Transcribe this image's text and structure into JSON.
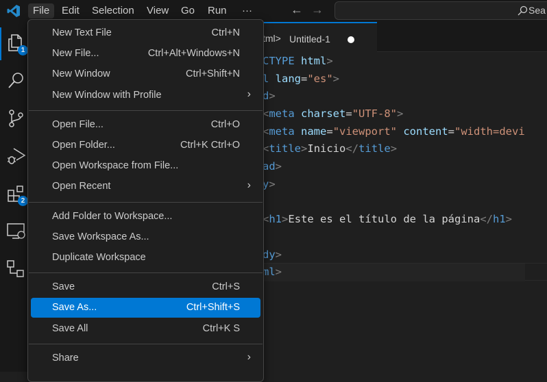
{
  "menubar": {
    "items": [
      "File",
      "Edit",
      "Selection",
      "View",
      "Go",
      "Run",
      "···"
    ],
    "active": "File"
  },
  "search": {
    "placeholder": "Sea"
  },
  "activity": [
    {
      "icon": "explorer-icon",
      "badge": "1"
    },
    {
      "icon": "search-icon"
    },
    {
      "icon": "source-control-icon"
    },
    {
      "icon": "run-debug-icon"
    },
    {
      "icon": "extensions-icon",
      "badge": "2"
    },
    {
      "icon": "remote-explorer-icon"
    },
    {
      "icon": "remote-tree-icon"
    }
  ],
  "tab": {
    "breadcrumb": "tml>",
    "title": "Untitled-1",
    "dirty": true
  },
  "file_menu": {
    "groups": [
      [
        {
          "label": "New Text File",
          "shortcut": "Ctrl+N"
        },
        {
          "label": "New File...",
          "shortcut": "Ctrl+Alt+Windows+N"
        },
        {
          "label": "New Window",
          "shortcut": "Ctrl+Shift+N"
        },
        {
          "label": "New Window with Profile",
          "submenu": true
        }
      ],
      [
        {
          "label": "Open File...",
          "shortcut": "Ctrl+O"
        },
        {
          "label": "Open Folder...",
          "shortcut": "Ctrl+K Ctrl+O"
        },
        {
          "label": "Open Workspace from File..."
        },
        {
          "label": "Open Recent",
          "submenu": true
        }
      ],
      [
        {
          "label": "Add Folder to Workspace..."
        },
        {
          "label": "Save Workspace As..."
        },
        {
          "label": "Duplicate Workspace"
        }
      ],
      [
        {
          "label": "Save",
          "shortcut": "Ctrl+S"
        },
        {
          "label": "Save As...",
          "shortcut": "Ctrl+Shift+S",
          "selected": true
        },
        {
          "label": "Save All",
          "shortcut": "Ctrl+K S"
        }
      ],
      [
        {
          "label": "Share",
          "submenu": true
        }
      ]
    ]
  },
  "code_lines": [
    [
      [
        "tg",
        "CTYPE "
      ],
      [
        "at",
        "html"
      ],
      [
        "pn",
        ">"
      ]
    ],
    [
      [
        "tg",
        "l "
      ],
      [
        "at",
        "lang"
      ],
      [
        "tx",
        "="
      ],
      [
        "st",
        "\"es\""
      ],
      [
        "pn",
        ">"
      ]
    ],
    [
      [
        "tg",
        "d"
      ],
      [
        "pn",
        ">"
      ]
    ],
    [
      [
        "pn",
        "<"
      ],
      [
        "tg",
        "meta "
      ],
      [
        "at",
        "charset"
      ],
      [
        "tx",
        "="
      ],
      [
        "st",
        "\"UTF-8\""
      ],
      [
        "pn",
        ">"
      ]
    ],
    [
      [
        "pn",
        "<"
      ],
      [
        "tg",
        "meta "
      ],
      [
        "at",
        "name"
      ],
      [
        "tx",
        "="
      ],
      [
        "st",
        "\"viewport\" "
      ],
      [
        "at",
        "content"
      ],
      [
        "tx",
        "="
      ],
      [
        "st",
        "\"width=devi"
      ]
    ],
    [
      [
        "pn",
        "<"
      ],
      [
        "tg",
        "title"
      ],
      [
        "pn",
        ">"
      ],
      [
        "tx",
        "Inicio"
      ],
      [
        "pn",
        "</"
      ],
      [
        "tg",
        "title"
      ],
      [
        "pn",
        ">"
      ]
    ],
    [
      [
        "tg",
        "ad"
      ],
      [
        "pn",
        ">"
      ]
    ],
    [
      [
        "tg",
        "y"
      ],
      [
        "pn",
        ">"
      ]
    ],
    [],
    [
      [
        "pn",
        "<"
      ],
      [
        "tg",
        "h1"
      ],
      [
        "pn",
        ">"
      ],
      [
        "tx",
        "Este es el título de la página"
      ],
      [
        "pn",
        "</"
      ],
      [
        "tg",
        "h1"
      ],
      [
        "pn",
        ">"
      ]
    ],
    [],
    [
      [
        "tg",
        "dy"
      ],
      [
        "pn",
        ">"
      ]
    ],
    [
      [
        "tg",
        "ml"
      ],
      [
        "pn",
        ">"
      ]
    ]
  ]
}
